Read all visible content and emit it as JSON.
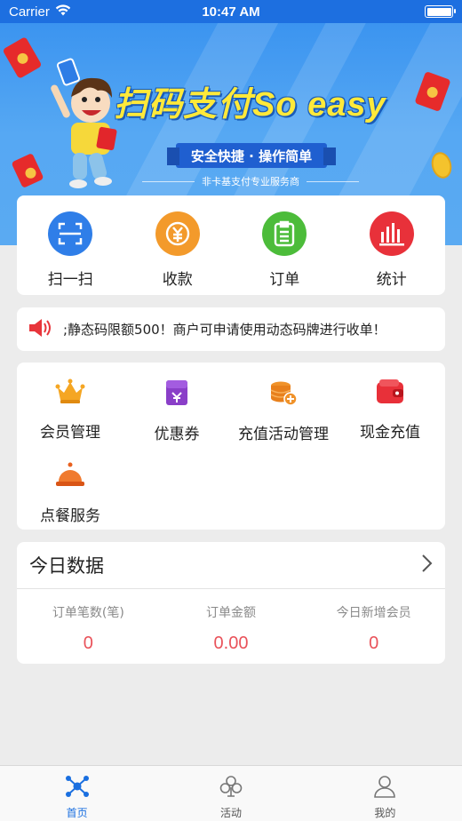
{
  "status_bar": {
    "carrier": "Carrier",
    "time": "10:47 AM"
  },
  "banner": {
    "title": "扫码支付So easy",
    "ribbon": "安全快捷 · 操作简单",
    "subtitle": "非卡基支付专业服务商"
  },
  "quick_actions": [
    {
      "label": "扫一扫",
      "icon": "scan-icon",
      "color": "#2f7ee8"
    },
    {
      "label": "收款",
      "icon": "yuan-collect-icon",
      "color": "#f39a2b"
    },
    {
      "label": "订单",
      "icon": "clipboard-icon",
      "color": "#4cbc3a"
    },
    {
      "label": "统计",
      "icon": "bar-chart-icon",
      "color": "#e8313a"
    }
  ],
  "notice": {
    "text": ";静态码限额500！商户可申请使用动态码牌进行收单！"
  },
  "services": [
    {
      "label": "会员管理",
      "icon": "crown-icon"
    },
    {
      "label": "优惠券",
      "icon": "coupon-icon"
    },
    {
      "label": "充值活动管理",
      "icon": "coins-add-icon"
    },
    {
      "label": "现金充值",
      "icon": "wallet-icon"
    },
    {
      "label": "点餐服务",
      "icon": "food-cloche-icon"
    }
  ],
  "today": {
    "title": "今日数据",
    "stats": [
      {
        "label": "订单笔数(笔)",
        "value": "0"
      },
      {
        "label": "订单金额",
        "value": "0.00"
      },
      {
        "label": "今日新增会员",
        "value": "0"
      }
    ]
  },
  "tabbar": [
    {
      "label": "首页",
      "icon": "home-network-icon",
      "active": true
    },
    {
      "label": "活动",
      "icon": "club-icon",
      "active": false
    },
    {
      "label": "我的",
      "icon": "user-icon",
      "active": false
    }
  ],
  "colors": {
    "accent": "#1a6fe0",
    "value_red": "#e9525a"
  }
}
